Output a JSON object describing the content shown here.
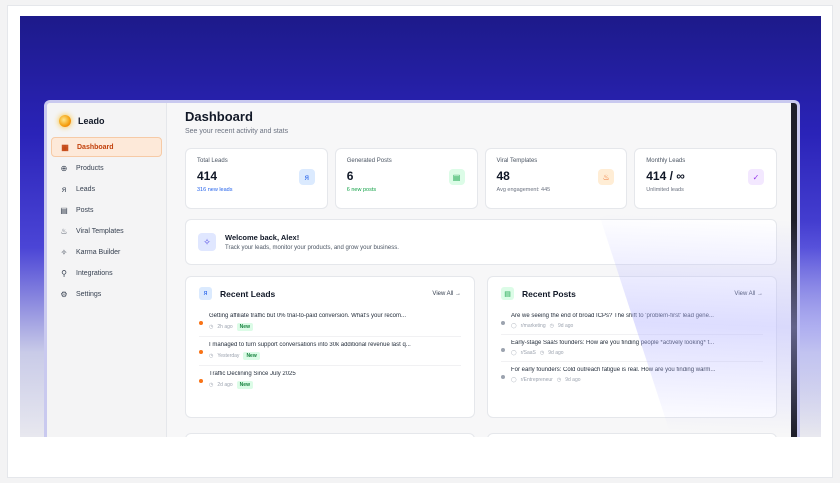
{
  "brand": {
    "name": "Leado"
  },
  "sidebar": {
    "items": [
      {
        "label": "Dashboard",
        "icon": "grid-icon",
        "glyph": "▦",
        "active": true
      },
      {
        "label": "Products",
        "icon": "box-icon",
        "glyph": "⊕"
      },
      {
        "label": "Leads",
        "icon": "users-icon",
        "glyph": "ᴙ"
      },
      {
        "label": "Posts",
        "icon": "document-icon",
        "glyph": "▤"
      },
      {
        "label": "Viral Templates",
        "icon": "flame-icon",
        "glyph": "♨"
      },
      {
        "label": "Karma Builder",
        "icon": "sparkles-icon",
        "glyph": "✧"
      },
      {
        "label": "Integrations",
        "icon": "plug-icon",
        "glyph": "⚲"
      },
      {
        "label": "Settings",
        "icon": "gear-icon",
        "glyph": "⚙"
      }
    ]
  },
  "header": {
    "title": "Dashboard",
    "subtitle": "See your recent activity and stats"
  },
  "stats": [
    {
      "label": "Total Leads",
      "value": "414",
      "note": "316 new leads",
      "note_color": "#2563eb",
      "icon": "users-icon",
      "glyph": "ᴙ",
      "icon_bg": "#dbeafe",
      "icon_fg": "#2563eb"
    },
    {
      "label": "Generated Posts",
      "value": "6",
      "note": "6 new posts",
      "note_color": "#16a34a",
      "icon": "document-icon",
      "glyph": "▤",
      "icon_bg": "#dcfce7",
      "icon_fg": "#16a34a"
    },
    {
      "label": "Viral Templates",
      "value": "48",
      "note": "Avg engagement: 445",
      "note_color": "#6b7280",
      "icon": "flame-icon",
      "glyph": "♨",
      "icon_bg": "#ffedd5",
      "icon_fg": "#ea580c"
    },
    {
      "label": "Monthly Leads",
      "value": "414 / ∞",
      "note": "Unlimited leads",
      "note_color": "#6b7280",
      "icon": "check-circle-icon",
      "glyph": "✓",
      "icon_bg": "#f3e8ff",
      "icon_fg": "#9333ea"
    }
  ],
  "welcome": {
    "title": "Welcome back, Alex!",
    "subtitle": "Track your leads, monitor your products, and grow your business.",
    "glyph": "✧"
  },
  "recent_leads": {
    "title": "Recent Leads",
    "view_all": "View All →",
    "glyph": "ᴙ",
    "items": [
      {
        "title": "Getting affiliate traffic but 0% trial-to-paid conversion. What's your recom...",
        "time": "2h ago",
        "badge": "New"
      },
      {
        "title": "I managed to turn support conversations into 30k additional revenue last q...",
        "time": "Yesterday",
        "badge": "New"
      },
      {
        "title": "Traffic Declining Since July 2025",
        "time": "2d ago",
        "badge": "New"
      }
    ]
  },
  "recent_posts": {
    "title": "Recent Posts",
    "view_all": "View All →",
    "glyph": "▤",
    "items": [
      {
        "title": "Are we seeing the end of broad ICPs? The shift to 'problem-first' lead gene...",
        "community": "r/marketing",
        "time": "9d ago"
      },
      {
        "title": "Early-stage SaaS founders: How are you finding people *actively looking* f...",
        "community": "r/SaaS",
        "time": "9d ago"
      },
      {
        "title": "For early founders: Cold outreach fatigue is real. How are you finding warm...",
        "community": "r/Entrepreneur",
        "time": "9d ago"
      }
    ]
  },
  "colors": {
    "accent": "#ea580c",
    "lead_dot": "#f97316",
    "post_dot": "#9ca3af"
  }
}
